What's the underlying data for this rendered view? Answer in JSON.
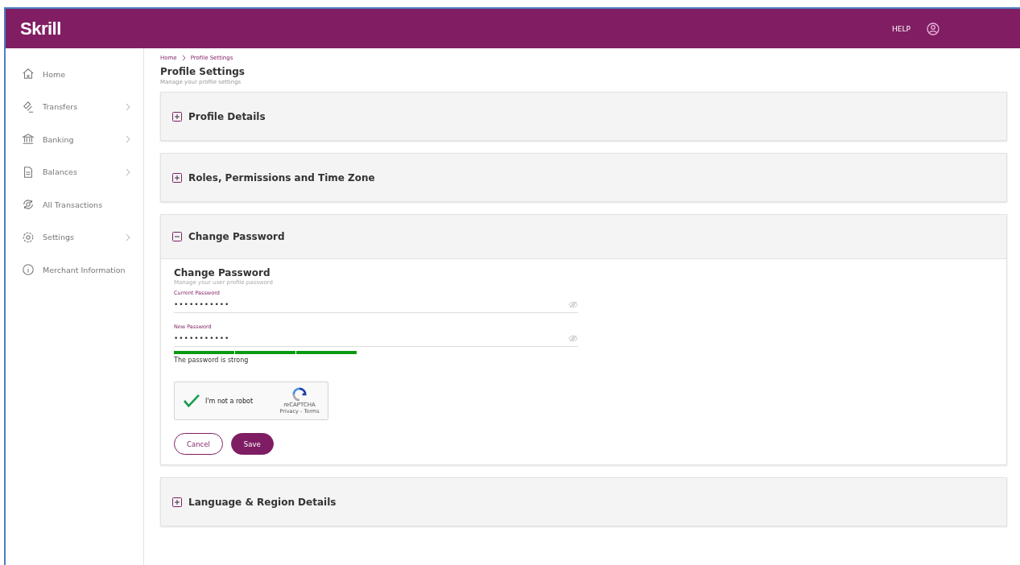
{
  "header": {
    "logo": "Skrill",
    "help": "HELP"
  },
  "sidebar": {
    "items": [
      {
        "label": "Home",
        "has_submenu": false
      },
      {
        "label": "Transfers",
        "has_submenu": true
      },
      {
        "label": "Banking",
        "has_submenu": true
      },
      {
        "label": "Balances",
        "has_submenu": true
      },
      {
        "label": "All Transactions",
        "has_submenu": false
      },
      {
        "label": "Settings",
        "has_submenu": true
      },
      {
        "label": "Merchant Information",
        "has_submenu": false
      }
    ]
  },
  "breadcrumb": [
    "Home",
    "Profile Settings"
  ],
  "page": {
    "title": "Profile Settings",
    "subtitle": "Manage your profile settings"
  },
  "sections": [
    {
      "title": "Profile Details",
      "expanded": false
    },
    {
      "title": "Roles, Permissions and Time Zone",
      "expanded": false
    },
    {
      "title": "Change Password",
      "expanded": true,
      "form": {
        "title": "Change Password",
        "subtitle": "Manage your user profile password",
        "fields": [
          {
            "label": "Current Password",
            "value": "•••••••••••"
          },
          {
            "label": "New Password",
            "value": "•••••••••••"
          }
        ],
        "strength": {
          "level": 1,
          "text": "The password is strong"
        },
        "captcha": {
          "checked": true,
          "label": "I'm not a robot",
          "brand": "reCAPTCHA",
          "links": "Privacy - Terms"
        },
        "buttons": [
          {
            "label": "Cancel",
            "kind": "secondary"
          },
          {
            "label": "Save",
            "kind": "primary"
          }
        ]
      }
    },
    {
      "title": "Language & Region Details",
      "expanded": false
    }
  ]
}
